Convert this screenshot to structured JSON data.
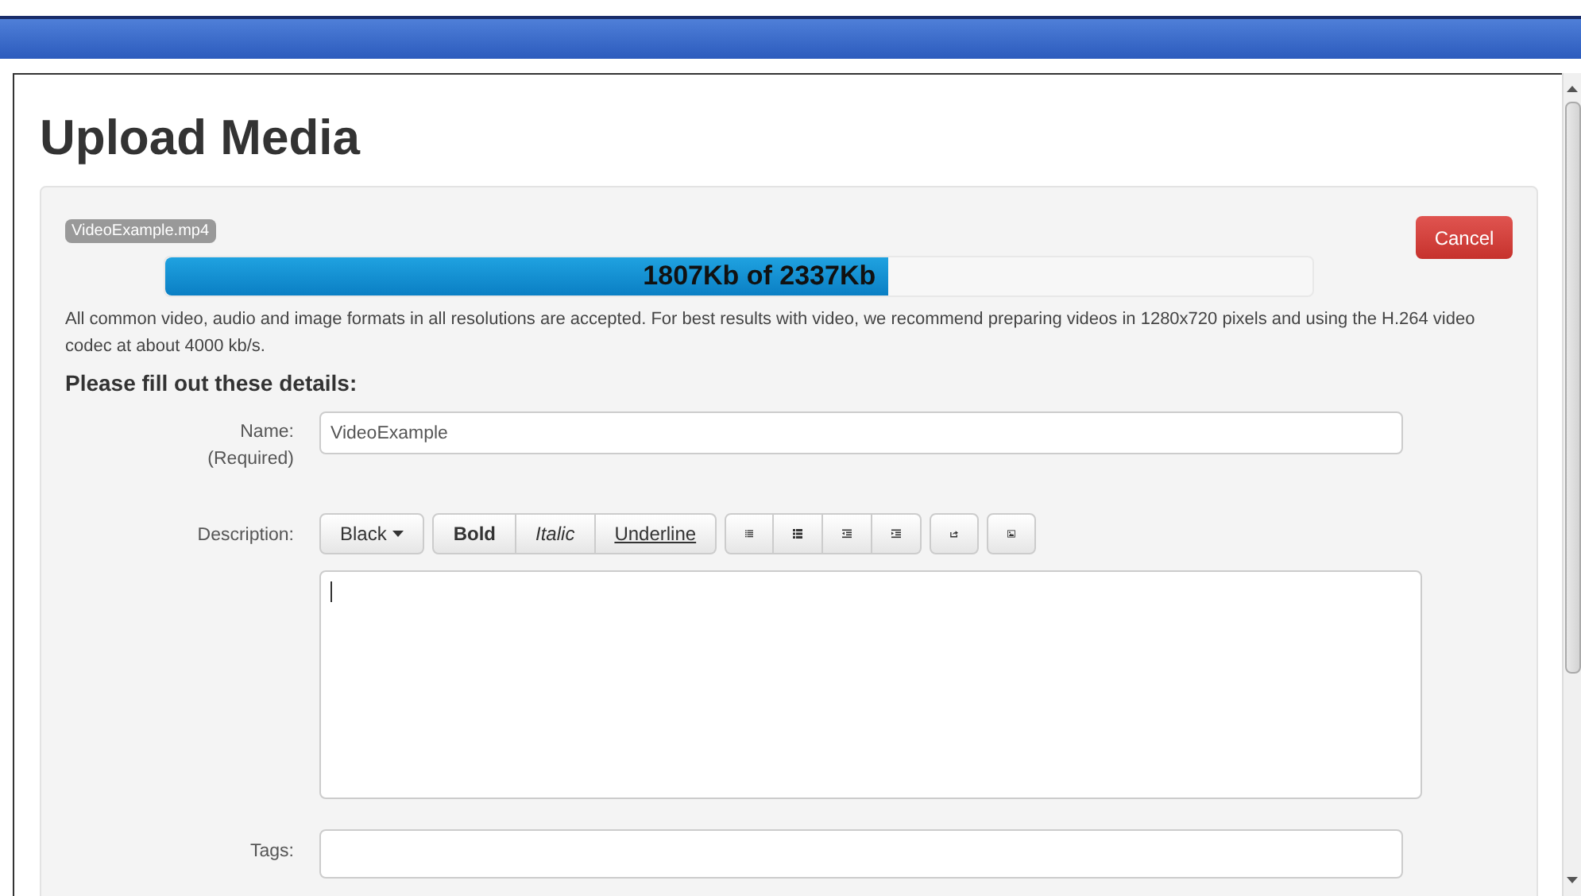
{
  "title": "Upload Media",
  "upload": {
    "file_name": "VideoExample.mp4",
    "progress_text": "1807Kb of 2337Kb",
    "level": 0.63,
    "cancel": "Cancel"
  },
  "notice": "All common video, audio and image formats in all resolutions are accepted. For best results with video, we recommend preparing videos in 1280x720 pixels and using the H.264 video codec at about 4000 kb/s.",
  "section_heading": "Please fill out these details:",
  "name_field": {
    "label": "Name:",
    "note": "(Required)",
    "value": "VideoExample"
  },
  "description": {
    "label": "Description:",
    "toolbar": [
      {
        "kind": "dropdown",
        "label": "Black"
      },
      {
        "kind": "bold",
        "label": "Bold"
      },
      {
        "kind": "italic",
        "label": "Italic"
      },
      {
        "kind": "underline",
        "label": "Underline"
      }
    ]
  },
  "tags_field": {
    "label": "Tags:"
  }
}
